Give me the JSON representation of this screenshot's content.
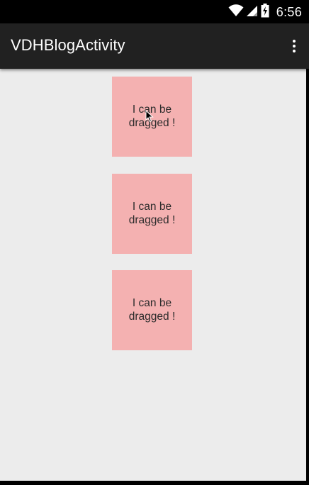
{
  "status_bar": {
    "time": "6:56",
    "icons": [
      "wifi-icon",
      "signal-icon",
      "battery-charging-icon"
    ]
  },
  "action_bar": {
    "title": "VDHBlogActivity",
    "overflow_icon": "overflow-menu-icon"
  },
  "content": {
    "background": "#ececec",
    "boxes": [
      {
        "label": "I can be dragged !"
      },
      {
        "label": "I can be dragged !"
      },
      {
        "label": "I can be dragged !"
      }
    ]
  },
  "colors": {
    "status_bar": "#000000",
    "action_bar": "#212121",
    "box": "#f4b1b1",
    "text": "#2b2b2b"
  }
}
